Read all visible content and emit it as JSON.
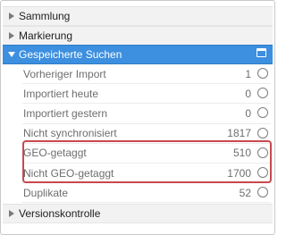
{
  "sections": {
    "sammlung": {
      "label": "Sammlung",
      "expanded": false
    },
    "markierung": {
      "label": "Markierung",
      "expanded": false
    },
    "gespeicherte_suchen": {
      "label": "Gespeicherte Suchen",
      "expanded": true
    },
    "versionskontrolle": {
      "label": "Versionskontrolle",
      "expanded": false
    }
  },
  "saved_searches": [
    {
      "label": "Vorheriger Import",
      "count": "1"
    },
    {
      "label": "Importiert heute",
      "count": "0"
    },
    {
      "label": "Importiert gestern",
      "count": "0"
    },
    {
      "label": "Nicht synchronisiert",
      "count": "1817"
    },
    {
      "label": "GEO-getaggt",
      "count": "510"
    },
    {
      "label": "Nicht GEO-getaggt",
      "count": "1700"
    },
    {
      "label": "Duplikate",
      "count": "52"
    }
  ],
  "colors": {
    "active_header": "#3d8fdf",
    "highlight_box": "#c8484d"
  },
  "icons": {
    "collapsed": "triangle-right-icon",
    "expanded": "triangle-down-icon",
    "window": "window-icon",
    "radio": "radio-icon"
  }
}
